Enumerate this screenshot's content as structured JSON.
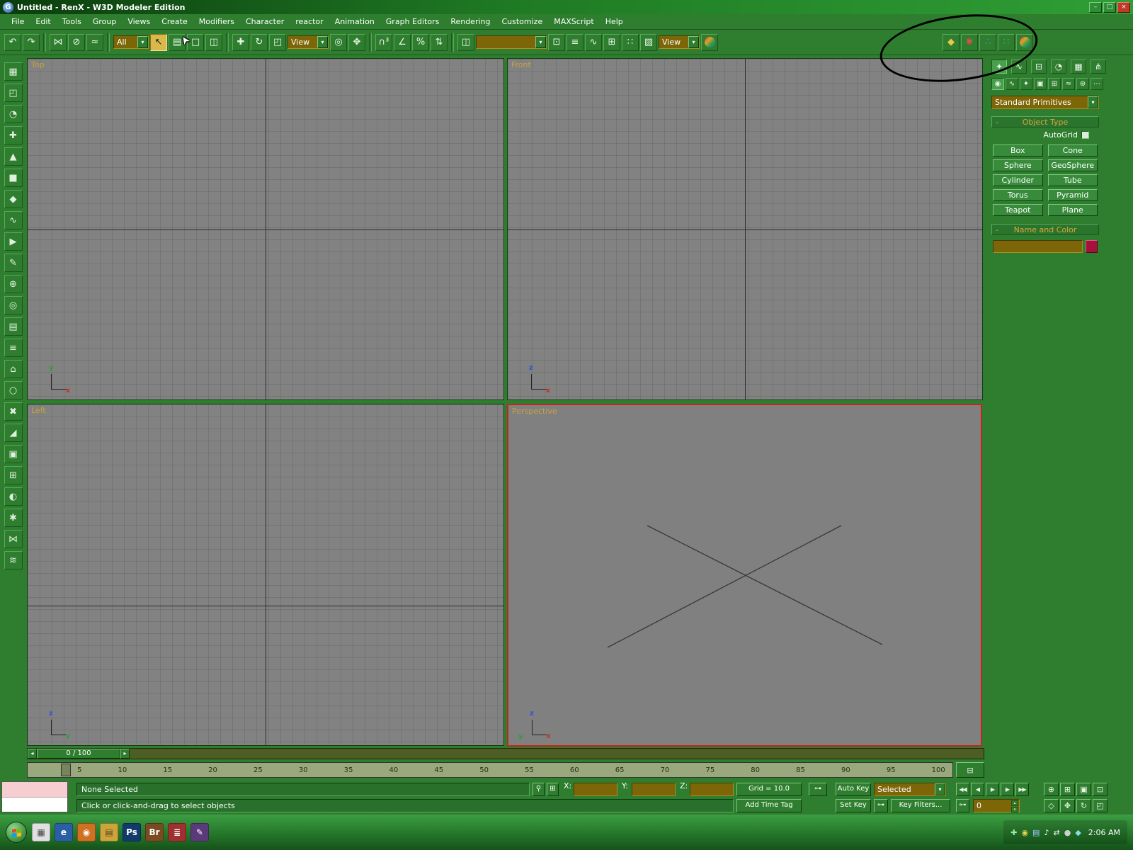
{
  "window": {
    "title": "Untitled - RenX - W3D Modeler Edition"
  },
  "colors": {
    "chrome_green": "#2f7e2f",
    "chrome_dark": "#1c541c",
    "viewport_bg": "#828282",
    "active_viewport_border": "#cc2218",
    "rollout_text": "#e0a23c",
    "field_olive": "#7d6608",
    "color_swatch": "#a8103c",
    "viewport_label": "#c8a33c"
  },
  "glyphs": {
    "app": "G",
    "minimize": "–",
    "maximize": "□",
    "close": "×",
    "dropdown_arrow": "▾",
    "slider_left": "◂",
    "slider_right": "▸",
    "lock": "⚲",
    "absolute_mode": "⊞",
    "key": "⊶",
    "key_filters_icon": "⊶",
    "spin_up": "▴",
    "spin_down": "▾",
    "rollout_collapse": "-",
    "trackbar_mini": "⊟",
    "cursor": "➤"
  },
  "menu": {
    "items": [
      "File",
      "Edit",
      "Tools",
      "Group",
      "Views",
      "Create",
      "Modifiers",
      "Character",
      "reactor",
      "Animation",
      "Graph Editors",
      "Rendering",
      "Customize",
      "MAXScript",
      "Help"
    ]
  },
  "toolbar": {
    "selection_filter_label": "All",
    "ref_coord_label": "View",
    "render_type_label": "View",
    "named_sets_value": "",
    "undo_redo": [
      {
        "name": "undo-icon",
        "glyph": "↶"
      },
      {
        "name": "redo-icon",
        "glyph": "↷"
      }
    ],
    "link_group": [
      {
        "name": "select-and-link-icon",
        "glyph": "⋈"
      },
      {
        "name": "unlink-selection-icon",
        "glyph": "⊘"
      },
      {
        "name": "bind-to-space-warp-icon",
        "glyph": "≈"
      }
    ],
    "select_group": [
      {
        "name": "select-object-icon",
        "glyph": "↖",
        "cls": "active"
      },
      {
        "name": "select-by-name-icon",
        "glyph": "▤"
      },
      {
        "name": "rectangular-selection-icon",
        "glyph": "□"
      },
      {
        "name": "window-crossing-icon",
        "glyph": "◫"
      }
    ],
    "transform_group": [
      {
        "name": "select-and-move-icon",
        "glyph": "✚"
      },
      {
        "name": "select-and-rotate-icon",
        "glyph": "↻"
      },
      {
        "name": "select-and-scale-icon",
        "glyph": "◰"
      }
    ],
    "center_group": [
      {
        "name": "use-center-icon",
        "glyph": "◎"
      },
      {
        "name": "select-and-manipulate-icon",
        "glyph": "✥"
      }
    ],
    "snap_group": [
      {
        "name": "snap-toggle-icon",
        "glyph": "∩³"
      },
      {
        "name": "angle-snap-icon",
        "glyph": "∠"
      },
      {
        "name": "percent-snap-icon",
        "glyph": "%"
      },
      {
        "name": "spinner-snap-icon",
        "glyph": "⇅"
      }
    ],
    "mirror_group": [
      {
        "name": "mirror-icon",
        "glyph": "◫"
      }
    ],
    "edit_group": [
      {
        "name": "align-icon",
        "glyph": "⊡"
      },
      {
        "name": "layer-manager-icon",
        "glyph": "≡"
      },
      {
        "name": "curve-editor-icon",
        "glyph": "∿"
      },
      {
        "name": "schematic-view-icon",
        "glyph": "⊞"
      },
      {
        "name": "material-editor-icon",
        "glyph": "∷"
      },
      {
        "name": "render-scene-icon",
        "glyph": "▨"
      }
    ],
    "render_group": [
      {
        "name": "quick-render-icon",
        "glyph": "●",
        "cls": "rainbow"
      }
    ],
    "w3d_group": [
      {
        "name": "w3d-material-icon",
        "glyph": "◆",
        "cls": "c-gold"
      },
      {
        "name": "w3d-vertex-paint-icon",
        "glyph": "✱",
        "cls": "c-red"
      },
      {
        "name": "w3d-bone-tools-icon",
        "glyph": "∴",
        "cls": "c-mix"
      },
      {
        "name": "w3d-id-tools-icon",
        "glyph": "∷",
        "cls": "c-rgb"
      },
      {
        "name": "w3d-export-icon",
        "glyph": "●",
        "cls": "rainbow"
      }
    ]
  },
  "left_toolbar": {
    "icons": [
      {
        "name": "viewport-config-icon",
        "glyph": "▦"
      },
      {
        "name": "transform-tool-icon",
        "glyph": "◰"
      },
      {
        "name": "rotate-tool-icon",
        "glyph": "◔"
      },
      {
        "name": "move-tool-icon",
        "glyph": "✚"
      },
      {
        "name": "select-tool-icon",
        "glyph": "▲"
      },
      {
        "name": "box-tool-icon",
        "glyph": "■"
      },
      {
        "name": "shape-tool-icon",
        "glyph": "◆"
      },
      {
        "name": "spline-tool-icon",
        "glyph": "∿"
      },
      {
        "name": "play-tool-icon",
        "glyph": "▶"
      },
      {
        "name": "pen-tool-icon",
        "glyph": "✎"
      },
      {
        "name": "add-tool-icon",
        "glyph": "⊕"
      },
      {
        "name": "target-tool-icon",
        "glyph": "◎"
      },
      {
        "name": "list-tool-icon",
        "glyph": "▤"
      },
      {
        "name": "stack-tool-icon",
        "glyph": "≡"
      },
      {
        "name": "home-tool-icon",
        "glyph": "⌂"
      },
      {
        "name": "circle-tool-icon",
        "glyph": "○"
      },
      {
        "name": "delete-tool-icon",
        "glyph": "✖"
      },
      {
        "name": "corner-tool-icon",
        "glyph": "◢"
      },
      {
        "name": "panel-tool-icon",
        "glyph": "▣"
      },
      {
        "name": "grid-tool-icon",
        "glyph": "⊞"
      },
      {
        "name": "sphere-tool-icon",
        "glyph": "◐"
      },
      {
        "name": "star-tool-icon",
        "glyph": "✱"
      },
      {
        "name": "link-tool-icon",
        "glyph": "⋈"
      },
      {
        "name": "wave-tool-icon",
        "glyph": "≋"
      }
    ]
  },
  "viewports": {
    "top": {
      "label": "Top",
      "axis_v": "y",
      "axis_h": "x"
    },
    "front": {
      "label": "Front",
      "axis_v": "z",
      "axis_h": "x"
    },
    "left": {
      "label": "Left",
      "axis_v": "z",
      "axis_h": "y"
    },
    "perspective": {
      "label": "Perspective",
      "axis_v": "z",
      "axis_h": "x",
      "axis_d": "y"
    }
  },
  "panel": {
    "tabs": [
      {
        "name": "tab-create-icon",
        "glyph": "✦",
        "cls": "active"
      },
      {
        "name": "tab-modify-icon",
        "glyph": "∿",
        "cls": "c-cyan"
      },
      {
        "name": "tab-hierarchy-icon",
        "glyph": "⊟"
      },
      {
        "name": "tab-motion-icon",
        "glyph": "◔"
      },
      {
        "name": "tab-display-icon",
        "glyph": "▦"
      },
      {
        "name": "tab-utilities-icon",
        "glyph": "⋔"
      }
    ],
    "categories": [
      {
        "name": "category-geometry-icon",
        "glyph": "◉",
        "cls": "active"
      },
      {
        "name": "category-shapes-icon",
        "glyph": "∿"
      },
      {
        "name": "category-lights-icon",
        "glyph": "✦",
        "cls": "c-gold"
      },
      {
        "name": "category-cameras-icon",
        "glyph": "▣"
      },
      {
        "name": "category-helpers-icon",
        "glyph": "⊞"
      },
      {
        "name": "category-spacewarps-icon",
        "glyph": "≈"
      },
      {
        "name": "category-systems-icon",
        "glyph": "⊛"
      },
      {
        "name": "category-more-icon",
        "glyph": "⋯"
      }
    ],
    "dropdown_label": "Standard Primitives",
    "object_type_title": "Object Type",
    "autogrid_label": "AutoGrid",
    "primitives": [
      {
        "name": "box-button",
        "label": "Box"
      },
      {
        "name": "cone-button",
        "label": "Cone"
      },
      {
        "name": "sphere-button",
        "label": "Sphere"
      },
      {
        "name": "geosphere-button",
        "label": "GeoSphere"
      },
      {
        "name": "cylinder-button",
        "label": "Cylinder"
      },
      {
        "name": "tube-button",
        "label": "Tube"
      },
      {
        "name": "torus-button",
        "label": "Torus"
      },
      {
        "name": "pyramid-button",
        "label": "Pyramid"
      },
      {
        "name": "teapot-button",
        "label": "Teapot"
      },
      {
        "name": "plane-button",
        "label": "Plane"
      }
    ],
    "name_color_title": "Name and Color"
  },
  "timeline": {
    "slider_label": "0 / 100",
    "ticks": [
      "5",
      "10",
      "15",
      "20",
      "25",
      "30",
      "35",
      "40",
      "45",
      "50",
      "55",
      "60",
      "65",
      "70",
      "75",
      "80",
      "85",
      "90",
      "95",
      "100"
    ]
  },
  "status": {
    "selection_status": "None Selected",
    "prompt": "Click or click-and-drag to select objects",
    "coord_x_label": "X:",
    "coord_y_label": "Y:",
    "coord_z_label": "Z:",
    "grid_label": "Grid = 10.0",
    "add_time_tag_label": "Add Time Tag",
    "auto_key_label": "Auto Key",
    "set_key_label": "Set Key",
    "key_mode_label": "Selected",
    "key_filters_label": "Key Filters...",
    "frame_value": "0",
    "playback": [
      {
        "name": "go-to-start-button",
        "glyph": "◀◀"
      },
      {
        "name": "previous-frame-button",
        "glyph": "◀"
      },
      {
        "name": "play-button",
        "glyph": "▶"
      },
      {
        "name": "next-frame-button",
        "glyph": "▶"
      },
      {
        "name": "go-to-end-button",
        "glyph": "▶▶"
      }
    ],
    "nav_row1": [
      {
        "name": "zoom-button",
        "glyph": "⊕"
      },
      {
        "name": "zoom-all-button",
        "glyph": "⊞"
      },
      {
        "name": "zoom-extents-button",
        "glyph": "▣"
      },
      {
        "name": "zoom-extents-all-button",
        "glyph": "⊡"
      }
    ],
    "nav_row2": [
      {
        "name": "field-of-view-button",
        "glyph": "◇"
      },
      {
        "name": "pan-button",
        "glyph": "✥"
      },
      {
        "name": "arc-rotate-button",
        "glyph": "↻"
      },
      {
        "name": "min-max-toggle-button",
        "glyph": "◰"
      }
    ]
  },
  "taskbar": {
    "clock": "2:06 AM",
    "quick_launch": [
      {
        "name": "show-desktop-icon",
        "glyph": "▦",
        "cls": "ql-gray"
      },
      {
        "name": "browser-icon",
        "glyph": "e",
        "cls": "ql-blue"
      },
      {
        "name": "media-player-icon",
        "glyph": "◉",
        "cls": "ql-orange"
      },
      {
        "name": "folder-icon",
        "glyph": "▤",
        "cls": "ql-gold"
      },
      {
        "name": "photoshop-icon",
        "glyph": "Ps",
        "cls": "ql-dkblue"
      },
      {
        "name": "bridge-icon",
        "glyph": "Br",
        "cls": "ql-brown"
      },
      {
        "name": "help-book-icon",
        "glyph": "≣",
        "cls": "ql-red"
      },
      {
        "name": "notes-icon",
        "glyph": "✎",
        "cls": "ql-purple"
      }
    ],
    "tray": [
      {
        "name": "antivirus-icon",
        "glyph": "✚",
        "cls": "t-green"
      },
      {
        "name": "update-icon",
        "glyph": "◉",
        "cls": "t-gold"
      },
      {
        "name": "display-settings-icon",
        "glyph": "▤",
        "cls": "t-blue"
      },
      {
        "name": "volume-icon",
        "glyph": "♪",
        "cls": "t-white"
      },
      {
        "name": "network-icon",
        "glyph": "⇄",
        "cls": "t-white"
      },
      {
        "name": "usb-icon",
        "glyph": "●",
        "cls": "t-gray"
      },
      {
        "name": "messenger-icon",
        "glyph": "◆",
        "cls": "t-cyan"
      }
    ]
  }
}
